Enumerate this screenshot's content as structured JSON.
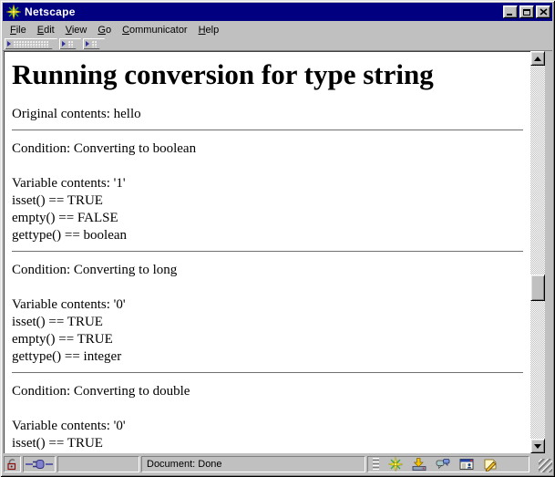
{
  "window": {
    "title": "Netscape",
    "control_icons": [
      "minimize-icon",
      "maximize-icon",
      "close-icon"
    ],
    "app_icon": "netscape-logo-icon"
  },
  "menu": {
    "items": [
      {
        "label": "File"
      },
      {
        "label": "Edit"
      },
      {
        "label": "View"
      },
      {
        "label": "Go"
      },
      {
        "label": "Communicator"
      },
      {
        "label": "Help"
      }
    ]
  },
  "toolbars": {
    "collapsed_tab_count": 3,
    "collapsed_tab_icon": "expand-arrow-icon"
  },
  "page": {
    "heading": "Running conversion for type string",
    "intro": "Original contents: hello",
    "sections": [
      {
        "condition": "Condition: Converting to boolean",
        "lines": [
          "Variable contents: '1'",
          "isset() == TRUE",
          "empty() == FALSE",
          "gettype() == boolean"
        ]
      },
      {
        "condition": "Condition: Converting to long",
        "lines": [
          "Variable contents: '0'",
          "isset() == TRUE",
          "empty() == TRUE",
          "gettype() == integer"
        ]
      },
      {
        "condition": "Condition: Converting to double",
        "lines": [
          "Variable contents: '0'",
          "isset() == TRUE"
        ]
      }
    ]
  },
  "scrollbar": {
    "orientation": "vertical",
    "icons": [
      "scroll-up-arrow-icon",
      "scroll-down-arrow-icon"
    ]
  },
  "statusbar": {
    "status_text": "Document: Done",
    "icons": [
      "security-lock-icon",
      "online-plug-icon",
      "navigator-icon",
      "inbox-icon",
      "discussions-icon",
      "address-book-icon",
      "composer-icon"
    ]
  },
  "colors": {
    "titlebar": "#000080",
    "chrome": "#c0c0c0",
    "content_bg": "#ffffff",
    "text": "#000000",
    "title_text": "#ffffff"
  }
}
